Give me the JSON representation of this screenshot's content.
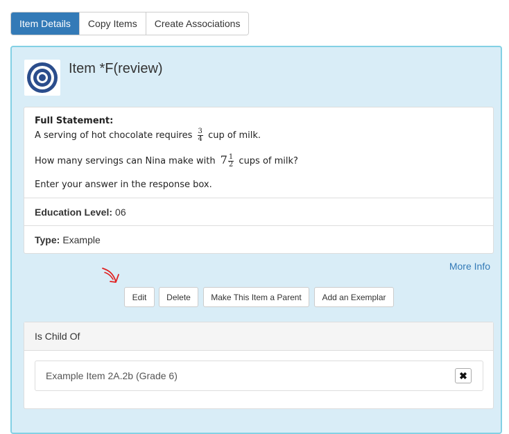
{
  "tabs": [
    {
      "label": "Item Details",
      "active": true
    },
    {
      "label": "Copy Items",
      "active": false
    },
    {
      "label": "Create Associations",
      "active": false
    }
  ],
  "item": {
    "title": "Item *F(review)",
    "logo_icon": "target-icon"
  },
  "statement": {
    "label": "Full Statement:",
    "line1_pre": "A serving of hot chocolate requires",
    "line1_frac_num": "3",
    "line1_frac_den": "4",
    "line1_post": "cup of milk.",
    "line2_pre": "How many servings can Nina make with",
    "line2_whole": "7",
    "line2_frac_num": "1",
    "line2_frac_den": "2",
    "line2_post": "cups of milk?",
    "line3": "Enter your answer in the response box."
  },
  "education_level": {
    "label": "Education Level:",
    "value": "06"
  },
  "type": {
    "label": "Type:",
    "value": "Example"
  },
  "more_info": "More Info",
  "actions": {
    "edit": "Edit",
    "delete": "Delete",
    "make_parent": "Make This Item a Parent",
    "add_exemplar": "Add an Exemplar"
  },
  "is_child_of": {
    "heading": "Is Child Of",
    "items": [
      {
        "label": "Example Item 2A.2b (Grade 6)",
        "remove_glyph": "✖"
      }
    ]
  },
  "colors": {
    "accent": "#337ab7",
    "panel_bg": "#d9edf7",
    "panel_border": "#83d0e4",
    "annotation": "#e02020"
  }
}
